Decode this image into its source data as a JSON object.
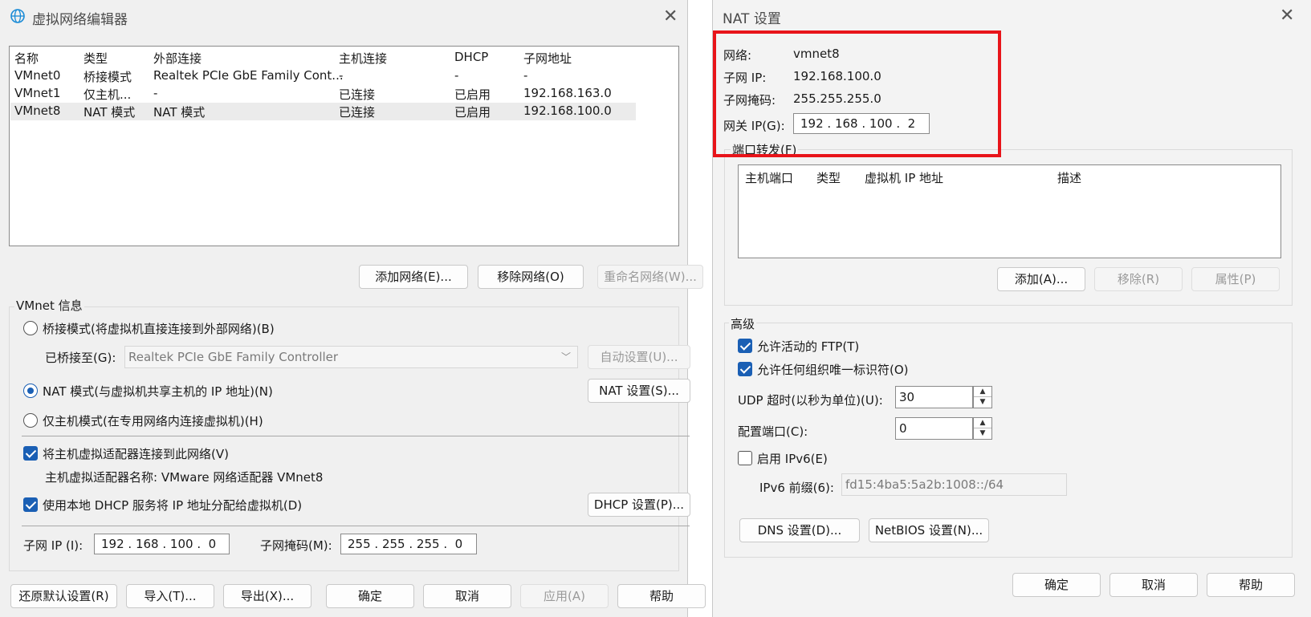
{
  "left_window": {
    "title": "虚拟网络编辑器",
    "icon": "globe-network-icon",
    "columns": [
      "名称",
      "类型",
      "外部连接",
      "主机连接",
      "DHCP",
      "子网地址"
    ],
    "rows": [
      [
        "VMnet0",
        "桥接模式",
        "Realtek PCIe GbE Family Cont...",
        "-",
        "-",
        "-"
      ],
      [
        "VMnet1",
        "仅主机...",
        "-",
        "已连接",
        "已启用",
        "192.168.163.0"
      ],
      [
        "VMnet8",
        "NAT 模式",
        "NAT 模式",
        "已连接",
        "已启用",
        "192.168.100.0"
      ]
    ],
    "selected_row": 2,
    "buttons": {
      "add_network": "添加网络(E)...",
      "remove_network": "移除网络(O)",
      "rename_network": "重命名网络(W)..."
    },
    "vmnet_info": {
      "label": "VMnet 信息",
      "bridged_mode": "桥接模式(将虚拟机直接连接到外部网络)(B)",
      "bridged_to_label": "已桥接至(G):",
      "bridged_to_value": "Realtek PCIe GbE Family Controller",
      "auto_settings": "自动设置(U)...",
      "nat_mode": "NAT 模式(与虚拟机共享主机的 IP 地址)(N)",
      "nat_settings": "NAT 设置(S)...",
      "host_only_mode": "仅主机模式(在专用网络内连接虚拟机)(H)",
      "connect_host_adapter": "将主机虚拟适配器连接到此网络(V)",
      "host_adapter_name": "主机虚拟适配器名称: VMware 网络适配器 VMnet8",
      "use_dhcp": "使用本地 DHCP 服务将 IP 地址分配给虚拟机(D)",
      "dhcp_settings": "DHCP 设置(P)...",
      "subnet_ip_label": "子网 IP (I):",
      "subnet_ip": [
        "192",
        "168",
        "100",
        "0"
      ],
      "subnet_mask_label": "子网掩码(M):",
      "subnet_mask": [
        "255",
        "255",
        "255",
        "0"
      ]
    },
    "bottom_buttons": {
      "restore_defaults": "还原默认设置(R)",
      "import": "导入(T)...",
      "export": "导出(X)...",
      "ok": "确定",
      "cancel": "取消",
      "apply": "应用(A)",
      "help": "帮助"
    }
  },
  "right_window": {
    "title": "NAT 设置",
    "network_label": "网络:",
    "network_value": "vmnet8",
    "subnet_ip_label": "子网 IP:",
    "subnet_ip_value": "192.168.100.0",
    "subnet_mask_label": "子网掩码:",
    "subnet_mask_value": "255.255.255.0",
    "gateway_label": "网关 IP(G):",
    "gateway_ip": [
      "192",
      "168",
      "100",
      "2"
    ],
    "port_forwarding": {
      "label": "端口转发(F)",
      "columns": [
        "主机端口",
        "类型",
        "虚拟机 IP 地址",
        "描述"
      ],
      "add": "添加(A)...",
      "remove": "移除(R)",
      "properties": "属性(P)"
    },
    "advanced": {
      "label": "高级",
      "allow_ftp": "允许活动的 FTP(T)",
      "allow_any_oui": "允许任何组织唯一标识符(O)",
      "udp_timeout_label": "UDP 超时(以秒为单位)(U):",
      "udp_timeout": "30",
      "config_port_label": "配置端口(C):",
      "config_port": "0",
      "enable_ipv6": "启用 IPv6(E)",
      "ipv6_prefix_label": "IPv6 前缀(6):",
      "ipv6_prefix": "fd15:4ba5:5a2b:1008::/64",
      "dns_settings": "DNS 设置(D)...",
      "netbios_settings": "NetBIOS 设置(N)..."
    },
    "bottom_buttons": {
      "ok": "确定",
      "cancel": "取消",
      "help": "帮助"
    }
  },
  "colors": {
    "highlight": "#e8141a",
    "accent": "#1a5fb4"
  }
}
